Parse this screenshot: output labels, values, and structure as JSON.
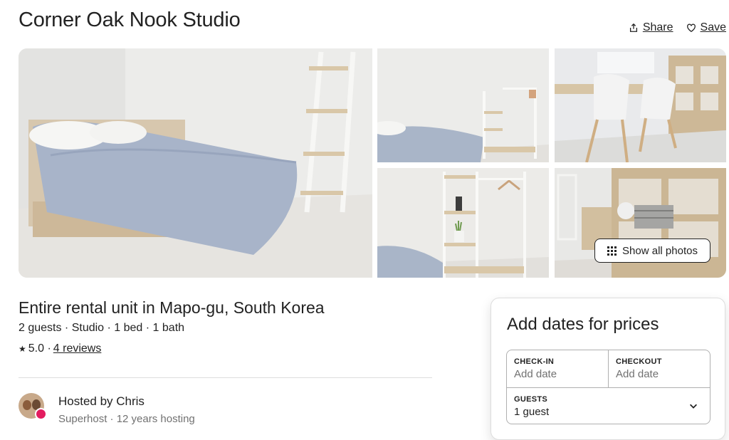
{
  "listing": {
    "title": "Corner Oak Nook Studio",
    "share_label": "Share",
    "save_label": "Save",
    "show_all_label": "Show all photos",
    "type_heading": "Entire rental unit in Mapo-gu, South Korea",
    "meta": "2 guests · Studio · 1 bed · 1 bath",
    "rating": "5.0 ·",
    "reviews_label": "4 reviews"
  },
  "host": {
    "name": "Hosted by Chris",
    "subtitle": "Superhost · 12 years hosting"
  },
  "booking": {
    "heading": "Add dates for prices",
    "checkin_label": "CHECK-IN",
    "checkin_value": "Add date",
    "checkout_label": "CHECKOUT",
    "checkout_value": "Add date",
    "guests_label": "GUESTS",
    "guests_value": "1 guest"
  },
  "icons": {
    "share": "share-icon",
    "save": "heart-icon",
    "grid": "grid-icon",
    "star": "star-icon",
    "chevron": "chevron-down-icon"
  },
  "colors": {
    "text": "#222222",
    "muted": "#717171",
    "accent": "#e31c5f",
    "border": "#b0b0b0"
  }
}
